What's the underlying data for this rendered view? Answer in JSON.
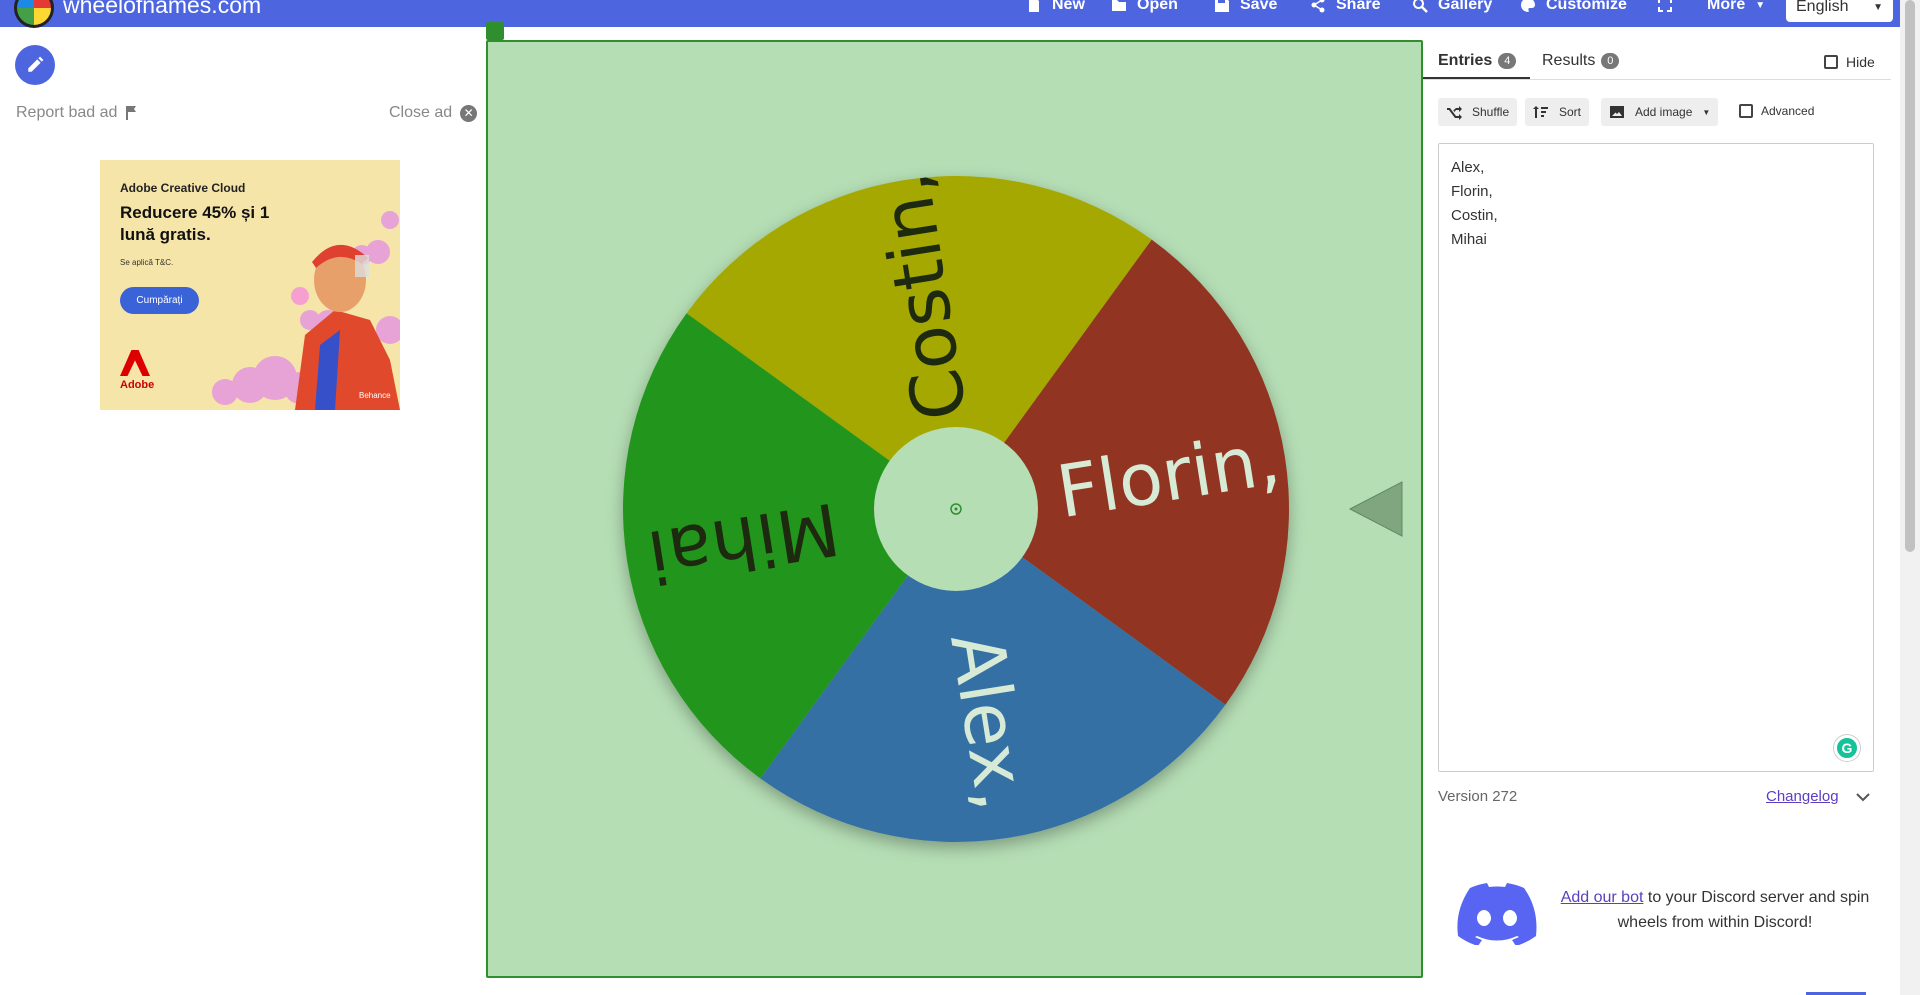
{
  "header": {
    "site_name": "wheelofnames.com",
    "nav": {
      "new": "New",
      "open": "Open",
      "save": "Save",
      "share": "Share",
      "gallery": "Gallery",
      "customize": "Customize",
      "more": "More"
    },
    "language": "English"
  },
  "left": {
    "report_ad": "Report bad ad",
    "close_ad": "Close ad",
    "ad": {
      "brand": "Adobe Creative Cloud",
      "headline": "Reducere 45% și 1 lună gratis.",
      "terms": "Se aplică T&C.",
      "cta": "Cumpărați",
      "logo_text": "Adobe",
      "behance": "Behance"
    }
  },
  "wheel": {
    "segments": [
      {
        "label": "Costin,",
        "color": "#a5a806"
      },
      {
        "label": "Florin,",
        "color": "#913522"
      },
      {
        "label": "Alex,",
        "color": "#3670a5"
      },
      {
        "label": "Mihai",
        "color": "#24961a"
      }
    ],
    "background": "#b5deb5",
    "border": "#2f8f2f"
  },
  "panel": {
    "tabs": {
      "entries": "Entries",
      "entries_count": "4",
      "results": "Results",
      "results_count": "0"
    },
    "hide": "Hide",
    "tools": {
      "shuffle": "Shuffle",
      "sort": "Sort",
      "add_image": "Add image",
      "advanced": "Advanced"
    },
    "entries_text": "Alex,\nFlorin,\nCostin,\nMihai",
    "version": "Version 272",
    "changelog": "Changelog",
    "discord": {
      "link": "Add our bot",
      "text": " to your Discord server and spin wheels from within Discord!"
    }
  }
}
